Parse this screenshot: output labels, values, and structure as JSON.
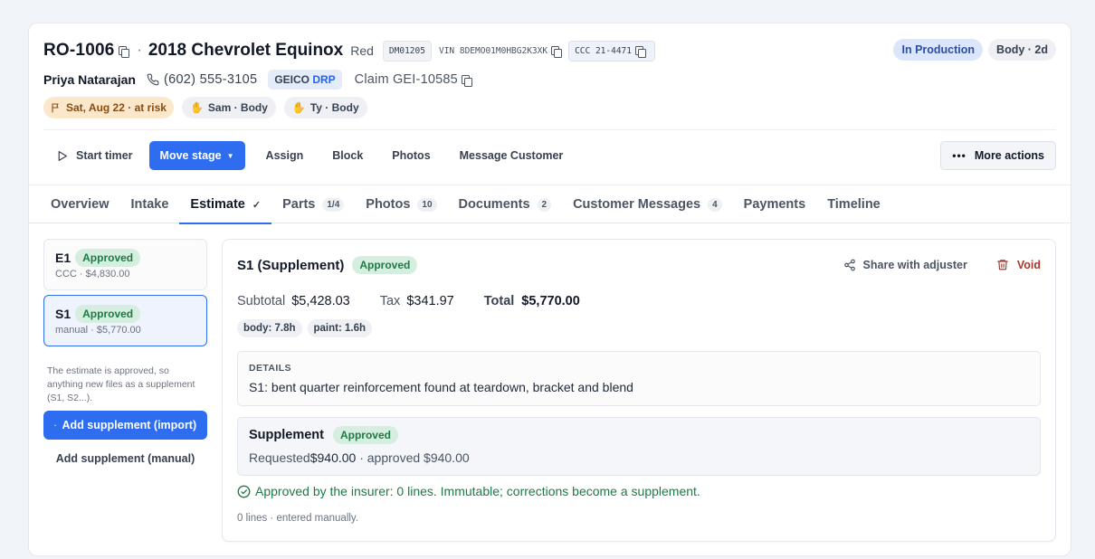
{
  "header": {
    "ro_number": "RO-1006",
    "separator": "·",
    "vehicle": "2018 Chevrolet Equinox",
    "color": "Red",
    "dm_code": "DM01205",
    "vin": "VIN 8DEMO01M0HBG2K3XK",
    "ccc": "CCC 21-4471",
    "status": "In Production",
    "dept_age": "Body · 2d",
    "customer": "Priya Natarajan",
    "phone": "(602) 555-3105",
    "insurer_prefix": "GEICO",
    "insurer_suffix": "DRP",
    "claim": "Claim GEI-10585",
    "due": "Sat, Aug 22 · at risk",
    "techs": [
      "Sam · Body",
      "Ty · Body"
    ]
  },
  "actions": {
    "start_timer": "Start timer",
    "move_stage": "Move stage",
    "assign": "Assign",
    "block": "Block",
    "photos": "Photos",
    "message_customer": "Message Customer",
    "more_actions": "More actions"
  },
  "tabs": [
    {
      "label": "Overview",
      "badge": ""
    },
    {
      "label": "Intake",
      "badge": ""
    },
    {
      "label": "Estimate",
      "badge": "✓"
    },
    {
      "label": "Parts",
      "badge": "1/4"
    },
    {
      "label": "Photos",
      "badge": "10"
    },
    {
      "label": "Documents",
      "badge": "2"
    },
    {
      "label": "Customer Messages",
      "badge": "4"
    },
    {
      "label": "Payments",
      "badge": ""
    },
    {
      "label": "Timeline",
      "badge": ""
    }
  ],
  "estimates": [
    {
      "code": "E1",
      "status": "Approved",
      "sub": "CCC · $4,830.00"
    },
    {
      "code": "S1",
      "status": "Approved",
      "sub": "manual · $5,770.00"
    }
  ],
  "left_note": "The estimate is approved, so anything new files as a supplement (S1, S2...).",
  "add_import": "Add supplement (import)",
  "add_manual": "Add supplement (manual)",
  "panel": {
    "title": "S1 (Supplement)",
    "status": "Approved",
    "share": "Share with adjuster",
    "void": "Void",
    "subtotal_label": "Subtotal",
    "subtotal": "$5,428.03",
    "tax_label": "Tax",
    "tax": "$341.97",
    "total_label": "Total",
    "total": "$5,770.00",
    "hours": [
      "body: 7.8h",
      "paint: 1.6h"
    ],
    "details_label": "DETAILS",
    "details_text": "S1: bent quarter reinforcement found at teardown, bracket and blend",
    "supplement_title": "Supplement",
    "supplement_status": "Approved",
    "requested_label": "Requested",
    "requested_value": "$940.00",
    "approved_rest": " · approved $940.00",
    "approved_line": "Approved by the insurer: 0 lines. Immutable; corrections become a supplement.",
    "lines_note": "0 lines · entered manually."
  },
  "colors": {
    "accent": "#2f6df0",
    "approved_bg": "#d6eee0",
    "approved_fg": "#1e7a45",
    "at_risk_bg": "#fbe8cc",
    "void_red": "#a33a2f"
  }
}
